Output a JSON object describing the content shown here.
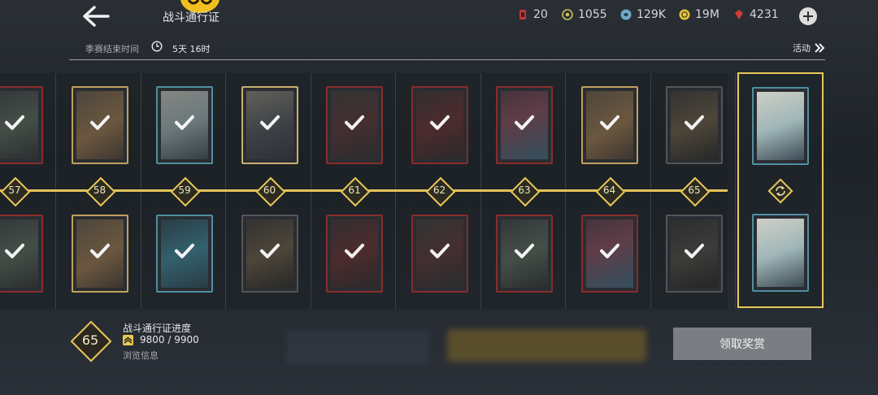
{
  "header": {
    "title": "战斗通行证",
    "back_icon": "back-arrow-icon"
  },
  "currencies": [
    {
      "name": "energy",
      "icon": "energy-can-icon",
      "value": "20",
      "color": "#b83a3a"
    },
    {
      "name": "coins-green",
      "icon": "gear-coin-icon",
      "value": "1055",
      "color": "#c7c05a"
    },
    {
      "name": "credits",
      "icon": "swirl-coin-icon",
      "value": "129K",
      "color": "#6fa8c8"
    },
    {
      "name": "gold",
      "icon": "gold-coin-icon",
      "value": "19M",
      "color": "#e0c341"
    },
    {
      "name": "gems",
      "icon": "red-gem-icon",
      "value": "4231",
      "color": "#d13a3a"
    }
  ],
  "season": {
    "label": "季赛结束时间",
    "time": "5天 16时",
    "activity_label": "活动"
  },
  "levels": [
    "57",
    "58",
    "59",
    "60",
    "61",
    "62",
    "63",
    "64",
    "65"
  ],
  "top_rewards": [
    {
      "type": "jar",
      "border": "#8a2c2c"
    },
    {
      "type": "key",
      "border": "#c0a060"
    },
    {
      "type": "canister",
      "border": "#4f8fa0"
    },
    {
      "type": "weapon",
      "border": "#c9b070"
    },
    {
      "type": "cans",
      "border": "#8a2c2c"
    },
    {
      "type": "emblem",
      "border": "#8a2c2c"
    },
    {
      "type": "crystal",
      "border": "#8a2c2c"
    },
    {
      "type": "key",
      "border": "#c0a060"
    },
    {
      "type": "portrait",
      "border": "#555"
    }
  ],
  "bottom_rewards": [
    {
      "type": "jar",
      "border": "#8a2c2c"
    },
    {
      "type": "key",
      "border": "#c0a060"
    },
    {
      "type": "crystal-blue",
      "border": "#4f8fa0"
    },
    {
      "type": "portrait",
      "border": "#555"
    },
    {
      "type": "emblem",
      "border": "#8a2c2c"
    },
    {
      "type": "cans",
      "border": "#8a2c2c"
    },
    {
      "type": "jar",
      "border": "#8a2c2c"
    },
    {
      "type": "crystal",
      "border": "#8a2c2c"
    },
    {
      "type": "cards",
      "border": "#555"
    }
  ],
  "final_reward": {
    "type": "canister",
    "border": "#4f8fa0"
  },
  "progress": {
    "level": "65",
    "title": "战斗通行证进度",
    "value": "9800 / 9900",
    "browse": "浏览信息"
  },
  "claim_button": "领取奖赏",
  "colors": {
    "accent": "#e8c857",
    "claim_bg": "#7a7e83"
  }
}
